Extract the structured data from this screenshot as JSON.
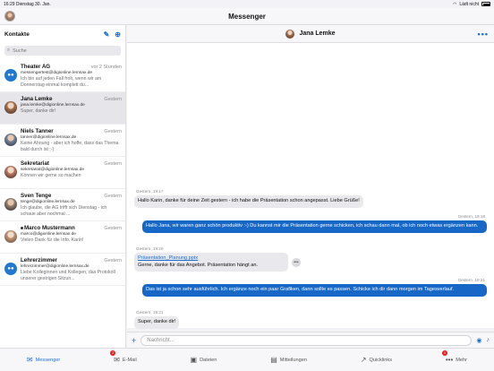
{
  "status": {
    "time": "16:29",
    "date": "Dienstag 30. Jan.",
    "battery": "Lädt nicht"
  },
  "app": {
    "title": "Messenger"
  },
  "sidebar": {
    "title": "Kontakte",
    "search_placeholder": "Suche",
    "contacts": [
      {
        "name": "Theater AG",
        "time": "vor 2 Stunden",
        "email": "messengertest@digionline.lernsax.de",
        "preview": "Ich bin auf jeden Fall froh, wenn wir am Donnerstag einmal komplett du..."
      },
      {
        "name": "Jana Lemke",
        "time": "Gestern",
        "email": "jana.lemke@digionline.lernsax.de",
        "preview": "Super, danke dir!"
      },
      {
        "name": "Niels Tanner",
        "time": "Gestern",
        "email": "tanner@digionline.lernsax.de",
        "preview": "Keine Ahnung - aber ich hoffe, dass das Thema bald durch ist ;-)"
      },
      {
        "name": "Sekretariat",
        "time": "Gestern",
        "email": "sekretariat@digionline.lernsax.de",
        "preview": "Können wir gerne so machen"
      },
      {
        "name": "Sven Tenge",
        "time": "Gestern",
        "email": "tenge@digionline.lernsax.de",
        "preview": "Ich glaube, die AG trifft sich Dienstag - ich schaue aber nochmal ..."
      },
      {
        "name": "Marco Mustermann",
        "time": "Gestern",
        "email": "marco@digionline.lernsax.de",
        "preview": "Vielen Dank für die Info, Karin!"
      },
      {
        "name": "Lehrerzimmer",
        "time": "Gestern",
        "email": "lehrerzimmer@digionline.lernsax.de",
        "preview": "Liebe Kolleginnen und Kollegen, das Protokoll unserer gestrigen Sitzun..."
      }
    ]
  },
  "chat": {
    "contact_name": "Jana Lemke",
    "messages": [
      {
        "meta": "Gestern, 19:17",
        "text": "Hallo Karin, danke für deine Zeit gestern - ich habe die Präsentation schon angepasst. Liebe Grüße!"
      },
      {
        "meta": "Gestern, 19:18",
        "text": "Hallo Jana, wir waren ganz schön produktiv :-) Du kannst mir die Präsentation gerne schicken, ich schau dann mal, ob ich noch etwas ergänzen kann."
      },
      {
        "meta": "Gestern, 19:20",
        "attachment": "Präsentation_Planung.pptx",
        "text": "Gerne, danke für das Angebot. Präsentation hängt an."
      },
      {
        "meta": "Gestern, 19:21",
        "text": "Das ist ja schon sehr ausführlich. Ich ergänze noch ein paar Grafiken, dann sollte es passen. Schicke ich dir dann morgen im Tagesverlauf."
      },
      {
        "meta": "Gestern, 19:21",
        "text": "Super, danke dir!"
      }
    ],
    "composer_placeholder": "Nachricht..."
  },
  "tabs": [
    {
      "label": "Messenger",
      "badge": ""
    },
    {
      "label": "E-Mail",
      "badge": "2"
    },
    {
      "label": "Dateien",
      "badge": ""
    },
    {
      "label": "Mitteilungen",
      "badge": ""
    },
    {
      "label": "Quicklinks",
      "badge": ""
    },
    {
      "label": "Mehr",
      "badge": "1"
    }
  ]
}
